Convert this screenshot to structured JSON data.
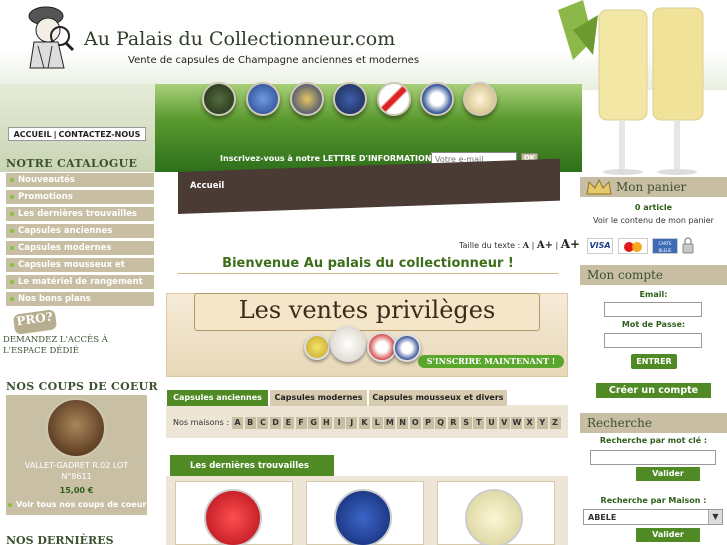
{
  "header": {
    "site_title": "Au Palais du Collectionneur.com",
    "tagline": "Vente de capsules de Champagne anciennes et modernes",
    "nav": [
      "ACCUEIL",
      "|",
      "CONTACTEZ-NOUS"
    ],
    "newsletter_text": "Inscrivez-vous à notre LETTRE D'INFORMATIONS",
    "newsletter_placeholder": "Votre e-mail",
    "newsletter_ok": "OK"
  },
  "sidebar": {
    "catalogue_title": "NOTRE CATALOGUE",
    "items": [
      "Nouveautés",
      "Promotions",
      "Les dernières trouvailles",
      "Capsules anciennes",
      "Capsules modernes",
      "Capsules mousseux et divers",
      "Le matériel de rangement",
      "Nos bons plans"
    ],
    "pro_badge": "PRO?",
    "pro_text_1": "DEMANDEZ L'ACCÈS À",
    "pro_text_2": "L'ESPACE DÉDIÉ",
    "coeur_title": "NOS COUPS DE COEUR",
    "coeur_name_1": "VALLET-GADRET R.02 LOT",
    "coeur_name_2": "N°8611",
    "coeur_price": "15,00 €",
    "coeur_all": "Voir tous nos coups de coeurs",
    "dernieres_title": "NOS DERNIÈRES"
  },
  "main": {
    "breadcrumb": "Accueil",
    "text_size_label": "Taille du texte :",
    "text_size_options": [
      "A",
      "|",
      "A+",
      "|",
      "A+"
    ],
    "welcome": "Bienvenue Au palais du collectionneur !",
    "banner_title": "Les ventes privilèges",
    "banner_cta": "S'INSCRIRE MAINTENANT !",
    "tabs": [
      "Capsules anciennes",
      "Capsules modernes",
      "Capsules mousseux et divers"
    ],
    "maisons_label": "Nos maisons :",
    "letters": [
      "A",
      "B",
      "C",
      "D",
      "E",
      "F",
      "G",
      "H",
      "I",
      "J",
      "K",
      "L",
      "M",
      "N",
      "O",
      "P",
      "Q",
      "R",
      "S",
      "T",
      "U",
      "V",
      "W",
      "X",
      "Y",
      "Z"
    ],
    "trouvailles_tab": "Les dernières trouvailles"
  },
  "right": {
    "panier_title": "Mon panier",
    "panier_count": "0 article",
    "panier_link": "Voir le contenu de mon panier",
    "cards": [
      "VISA",
      "MasterCard",
      "CARTE BLEUE"
    ],
    "compte_title": "Mon compte",
    "email_label": "Email:",
    "password_label": "Mot de Passe:",
    "entrer": "ENTRER",
    "creer": "Créer un compte",
    "recherche_title": "Recherche",
    "motcle_label": "Recherche par mot clé :",
    "valider": "Valider",
    "maison_label": "Recherche par Maison :",
    "maison_selected": "ABELE",
    "valider2": "Valider"
  },
  "colors": {
    "brand_green": "#4f8a25",
    "beige": "#c8bea3",
    "dark_brown": "#4a3c34"
  }
}
